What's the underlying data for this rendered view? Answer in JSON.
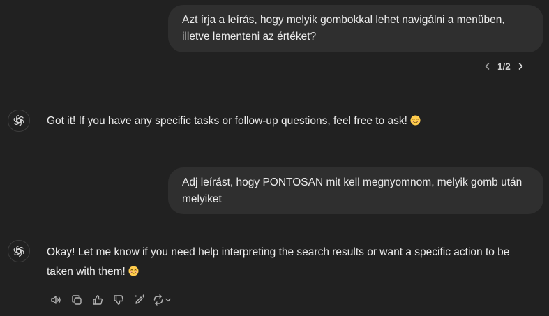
{
  "messages": [
    {
      "role": "user",
      "text": "Azt írja a leírás, hogy melyik gombokkal lehet navigálni a menüben, illetve lementeni az értéket?",
      "pager": {
        "label": "1/2"
      }
    },
    {
      "role": "assistant",
      "text": "Got it! If you have any specific tasks or follow-up questions, feel free to ask!",
      "emoji": "smiling-face-emoji"
    },
    {
      "role": "user",
      "text": "Adj leírást, hogy PONTOSAN mit kell megnyomnom, melyik gomb után melyiket"
    },
    {
      "role": "assistant",
      "text": "Okay! Let me know if you need help interpreting the search results or want a specific action to be taken with them!",
      "emoji": "smiling-face-emoji"
    }
  ],
  "action_bar": {
    "icons": [
      "read-aloud-icon",
      "copy-icon",
      "thumbs-up-icon",
      "thumbs-down-icon",
      "edit-sparkle-icon",
      "regenerate-icon",
      "chevron-down-icon"
    ]
  },
  "colors": {
    "background": "#212121",
    "bubble": "#2f2f2f",
    "text": "#ececec",
    "icon": "#b4b4b4"
  }
}
